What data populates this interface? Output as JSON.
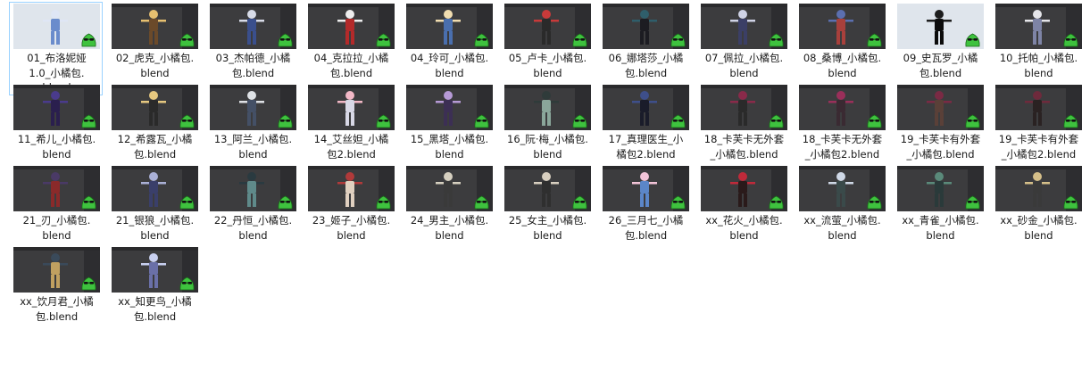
{
  "files": [
    {
      "name": "01_布洛妮娅1.0_小橘包.blend",
      "lines": [
        "01_布洛妮娅",
        "1.0_小橘包.",
        "blend"
      ],
      "selected": true,
      "colors": [
        "#dfe6f5",
        "#6a8ccc"
      ],
      "light": true
    },
    {
      "name": "02_虎克_小橘包.blend",
      "lines": [
        "02_虎克_小橘包.",
        "blend"
      ],
      "colors": [
        "#e7c070",
        "#6b4a2a"
      ]
    },
    {
      "name": "03_杰帕德_小橘包.blend",
      "lines": [
        "03_杰帕德_小橘",
        "包.blend"
      ],
      "colors": [
        "#d8dce8",
        "#3a4f8c"
      ]
    },
    {
      "name": "04_克拉拉_小橘包.blend",
      "lines": [
        "04_克拉拉_小橘",
        "包.blend"
      ],
      "colors": [
        "#eeeeee",
        "#b32a2a"
      ]
    },
    {
      "name": "04_玲可_小橘包.blend",
      "lines": [
        "04_玲可_小橘包.",
        "blend"
      ],
      "colors": [
        "#f1ddb0",
        "#4a6fae"
      ]
    },
    {
      "name": "05_卢卡_小橘包.blend",
      "lines": [
        "05_卢卡_小橘包.",
        "blend"
      ],
      "colors": [
        "#c83a3a",
        "#2a2a2a"
      ]
    },
    {
      "name": "06_娜塔莎_小橘包.blend",
      "lines": [
        "06_娜塔莎_小橘",
        "包.blend"
      ],
      "colors": [
        "#2f5e6b",
        "#1c1c22"
      ]
    },
    {
      "name": "07_佩拉_小橘包.blend",
      "lines": [
        "07_佩拉_小橘包.",
        "blend"
      ],
      "colors": [
        "#cfd3e6",
        "#3b3f66"
      ]
    },
    {
      "name": "08_桑博_小橘包.blend",
      "lines": [
        "08_桑博_小橘包.",
        "blend"
      ],
      "colors": [
        "#5b6fb0",
        "#a8403c"
      ]
    },
    {
      "name": "09_史瓦罗_小橘包.blend",
      "lines": [
        "09_史瓦罗_小橘",
        "包.blend"
      ],
      "colors": [
        "#1d1d1d",
        "#0c0c0c"
      ],
      "light": true
    },
    {
      "name": "10_托帕_小橘包.blend",
      "lines": [
        "10_托帕_小橘包.",
        "blend"
      ],
      "colors": [
        "#e6e6ea",
        "#7e84a6"
      ]
    },
    {
      "name": "11_希儿_小橘包.blend",
      "lines": [
        "11_希儿_小橘包.",
        "blend"
      ],
      "colors": [
        "#4a3b8c",
        "#2a1f4e"
      ]
    },
    {
      "name": "12_希露瓦_小橘包.blend",
      "lines": [
        "12_希露瓦_小橘",
        "包.blend"
      ],
      "colors": [
        "#e6c880",
        "#2a2a2a"
      ]
    },
    {
      "name": "13_阿兰_小橘包.blend",
      "lines": [
        "13_阿兰_小橘包.",
        "blend"
      ],
      "colors": [
        "#dfe2e6",
        "#445066"
      ]
    },
    {
      "name": "14_艾丝妲_小橘包2.blend",
      "lines": [
        "14_艾丝妲_小橘",
        "包2.blend"
      ],
      "colors": [
        "#f2b8c6",
        "#d8d8e6"
      ]
    },
    {
      "name": "15_黑塔_小橘包.blend",
      "lines": [
        "15_黑塔_小橘包.",
        "blend"
      ],
      "colors": [
        "#b69ad6",
        "#3c2f54"
      ]
    },
    {
      "name": "16_阮·梅_小橘包.blend",
      "lines": [
        "16_阮·梅_小橘包.",
        "blend"
      ],
      "colors": [
        "#2f3b3a",
        "#8aa69a"
      ]
    },
    {
      "name": "17_真理医生_小橘包2.blend",
      "lines": [
        "17_真理医生_小",
        "橘包2.blend"
      ],
      "colors": [
        "#3e4f8a",
        "#1a1c2a"
      ]
    },
    {
      "name": "18_卡芙卡无外套_小橘包.blend",
      "lines": [
        "18_卡芙卡无外套",
        "_小橘包.blend"
      ],
      "colors": [
        "#8a2a4a",
        "#2a2a2a"
      ]
    },
    {
      "name": "18_卡芙卡无外套_小橘包2.blend",
      "lines": [
        "18_卡芙卡无外套",
        "_小橘包2.blend"
      ],
      "colors": [
        "#9a2f5a",
        "#3a2a32"
      ]
    },
    {
      "name": "19_卡芙卡有外套_小橘包.blend",
      "lines": [
        "19_卡芙卡有外套",
        "_小橘包.blend"
      ],
      "colors": [
        "#7a2a44",
        "#5a4038"
      ]
    },
    {
      "name": "19_卡芙卡有外套_小橘包2.blend",
      "lines": [
        "19_卡芙卡有外套",
        "_小橘包2.blend"
      ],
      "colors": [
        "#6e2a3c",
        "#2a2222"
      ]
    },
    {
      "name": "21_刃_小橘包.blend",
      "lines": [
        "21_刃_小橘包.",
        "blend"
      ],
      "colors": [
        "#4a3a66",
        "#8a2a2a"
      ]
    },
    {
      "name": "21_银狼_小橘包.blend",
      "lines": [
        "21_银狼_小橘包.",
        "blend"
      ],
      "colors": [
        "#aab0d6",
        "#3a3f6a"
      ]
    },
    {
      "name": "22_丹恒_小橘包.blend",
      "lines": [
        "22_丹恒_小橘包.",
        "blend"
      ],
      "colors": [
        "#2a3a40",
        "#5f8a8a"
      ]
    },
    {
      "name": "23_姬子_小橘包.blend",
      "lines": [
        "23_姬子_小橘包.",
        "blend"
      ],
      "colors": [
        "#b03a3a",
        "#e0d0c0"
      ]
    },
    {
      "name": "24_男主_小橘包.blend",
      "lines": [
        "24_男主_小橘包.",
        "blend"
      ],
      "colors": [
        "#d6d0c0",
        "#3a3a3a"
      ]
    },
    {
      "name": "25_女主_小橘包.blend",
      "lines": [
        "25_女主_小橘包.",
        "blend"
      ],
      "colors": [
        "#d8cfc0",
        "#2f2f2f"
      ]
    },
    {
      "name": "26_三月七_小橘包.blend",
      "lines": [
        "26_三月七_小橘",
        "包.blend"
      ],
      "colors": [
        "#f2c4d8",
        "#5b86c8"
      ]
    },
    {
      "name": "xx_花火_小橘包.blend",
      "lines": [
        "xx_花火_小橘包.",
        "blend"
      ],
      "colors": [
        "#c02a3a",
        "#2a1a1a"
      ]
    },
    {
      "name": "xx_流萤_小橘包.blend",
      "lines": [
        "xx_流萤_小橘包.",
        "blend"
      ],
      "colors": [
        "#cfd8e6",
        "#3a4a4a"
      ]
    },
    {
      "name": "xx_青雀_小橘包.blend",
      "lines": [
        "xx_青雀_小橘包.",
        "blend"
      ],
      "colors": [
        "#5a8a7a",
        "#2a3a3a"
      ]
    },
    {
      "name": "xx_砂金_小橘包.blend",
      "lines": [
        "xx_砂金_小橘包.",
        "blend"
      ],
      "colors": [
        "#d6c08a",
        "#3a3a3a"
      ]
    },
    {
      "name": "xx_饮月君_小橘包.blend",
      "lines": [
        "xx_饮月君_小橘",
        "包.blend"
      ],
      "colors": [
        "#3a4a5a",
        "#c0a060"
      ]
    },
    {
      "name": "xx_知更鸟_小橘包.blend",
      "lines": [
        "xx_知更鸟_小橘",
        "包.blend"
      ],
      "colors": [
        "#c8d0f0",
        "#6a70a8"
      ]
    }
  ],
  "icons": {
    "mascot": "green-blob-mascot-icon",
    "file_type": "blend-file-thumbnail-icon"
  },
  "colors": {
    "selection_border": "#99d1ff",
    "viewport_bg": "#3c3c3e",
    "mascot_green": "#3ec23e",
    "text": "#1a1a1a"
  }
}
